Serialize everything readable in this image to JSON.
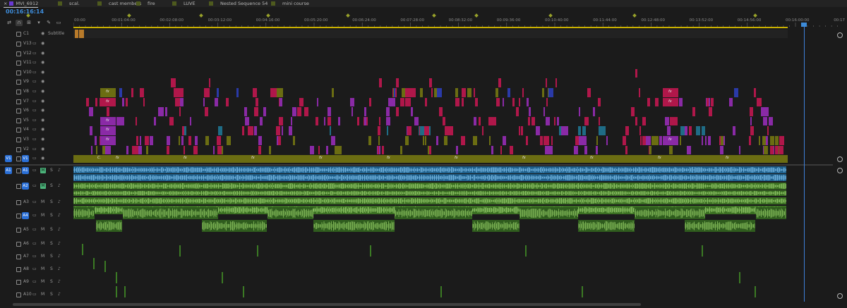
{
  "tabs": [
    {
      "label": "MVI_6912",
      "color": "#6a39d4",
      "active": true
    },
    {
      "label": "scal.",
      "color": "#4e5a1e"
    },
    {
      "label": "cast members",
      "color": "#4e5a1e"
    },
    {
      "label": "fire",
      "color": "#4e5a1e"
    },
    {
      "label": "LUVE",
      "color": "#4e5a1e"
    },
    {
      "label": "Nested Sequence 54",
      "color": "#4e5a1e"
    },
    {
      "label": "mini course",
      "color": "#4e5a1e"
    }
  ],
  "close_icon": "×",
  "timecode": "00:16:16:14",
  "tools": [
    "ripple-icon",
    "snap-icon",
    "linked-icon",
    "marker-icon",
    "wrench-icon",
    "captions-icon"
  ],
  "ruler": {
    "labels": [
      "00:00",
      "00:01:04:00",
      "00:02:08:00",
      "00:03:12:00",
      "00:04:16:00",
      "00:05:20:00",
      "00:06:24:00",
      "00:07:28:00",
      "00:08:32:00",
      "00:09:36:00",
      "00:10:40:00",
      "00:11:44:00",
      "00:12:48:00",
      "00:13:52:00",
      "00:14:56:00",
      "00:16:00:00",
      "00:17"
    ]
  },
  "subtitle_track": {
    "name": "C1",
    "label": "Subtitle"
  },
  "video_tracks": [
    "V13",
    "V12",
    "V11",
    "V10",
    "V9",
    "V8",
    "V7",
    "V6",
    "V5",
    "V4",
    "V3",
    "V2",
    "V1"
  ],
  "audio_tracks": [
    "A1",
    "A2",
    "A3",
    "A4",
    "A5",
    "A6",
    "A7",
    "A8",
    "A9",
    "A10"
  ],
  "source_patch": {
    "video": "V1",
    "audio": "A1"
  },
  "mute_label": "M",
  "solo_label": "S",
  "fx_label": "fx",
  "v1_clip_label": "C.",
  "colors": {
    "magenta": "#b0174a",
    "violet": "#8a2aa6",
    "olive": "#6b6d12",
    "blue": "#2a3aa8",
    "teal": "#1f6c86",
    "audio_blue": "#4a9bd0",
    "audio_green": "#4c8a2a",
    "playhead": "#3d7fd8"
  }
}
